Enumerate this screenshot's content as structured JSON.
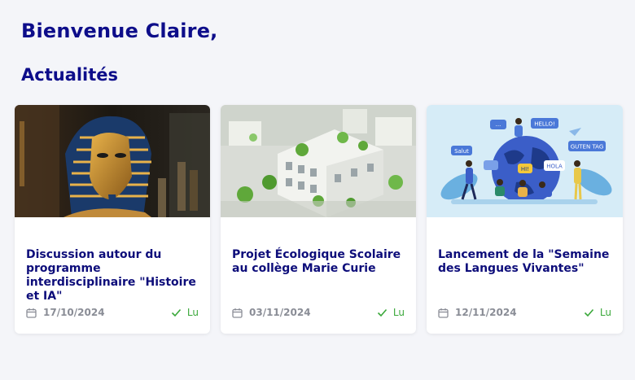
{
  "header": {
    "greeting": "Bienvenue Claire,",
    "section_title": "Actualités"
  },
  "news": [
    {
      "title": "Discussion autour du programme interdisciplinaire \"Histoire et IA\"",
      "date": "17/10/2024",
      "status": "Lu",
      "image": "pharaoh-mask-image"
    },
    {
      "title": "Projet Écologique Scolaire au collège Marie Curie",
      "date": "03/11/2024",
      "status": "Lu",
      "image": "green-buildings-model-image"
    },
    {
      "title": "Lancement de la \"Semaine des Langues Vivantes\"",
      "date": "12/11/2024",
      "status": "Lu",
      "image": "languages-globe-illustration"
    }
  ],
  "globe_bubbles": [
    "HELLO!",
    "GUTEN TAG",
    "HOLA",
    "HI!",
    "...",
    "Salut"
  ],
  "colors": {
    "heading": "#0d0d8a",
    "status_read": "#3aa83a",
    "date_text": "#8a8d96",
    "background": "#f4f5f9"
  },
  "icons": {
    "date": "calendar-icon",
    "status": "check-icon"
  }
}
